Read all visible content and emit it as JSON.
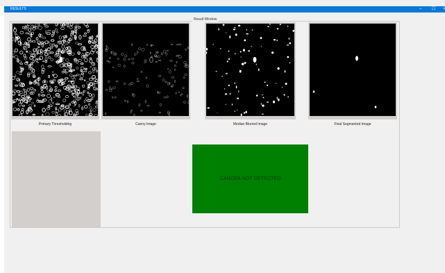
{
  "window": {
    "title": "RESULTS",
    "controls": {
      "minimize": "–",
      "maximize": "☐",
      "close": "×"
    }
  },
  "group": {
    "label": "Result Window"
  },
  "images": [
    {
      "caption": "Primary Thresholding"
    },
    {
      "caption": "Canny Image"
    },
    {
      "caption": "Median Blurred Image"
    },
    {
      "caption": "Final Segmented Image"
    }
  ],
  "status": {
    "text": "CANCER NOT DETECTED",
    "color": "#008000"
  }
}
